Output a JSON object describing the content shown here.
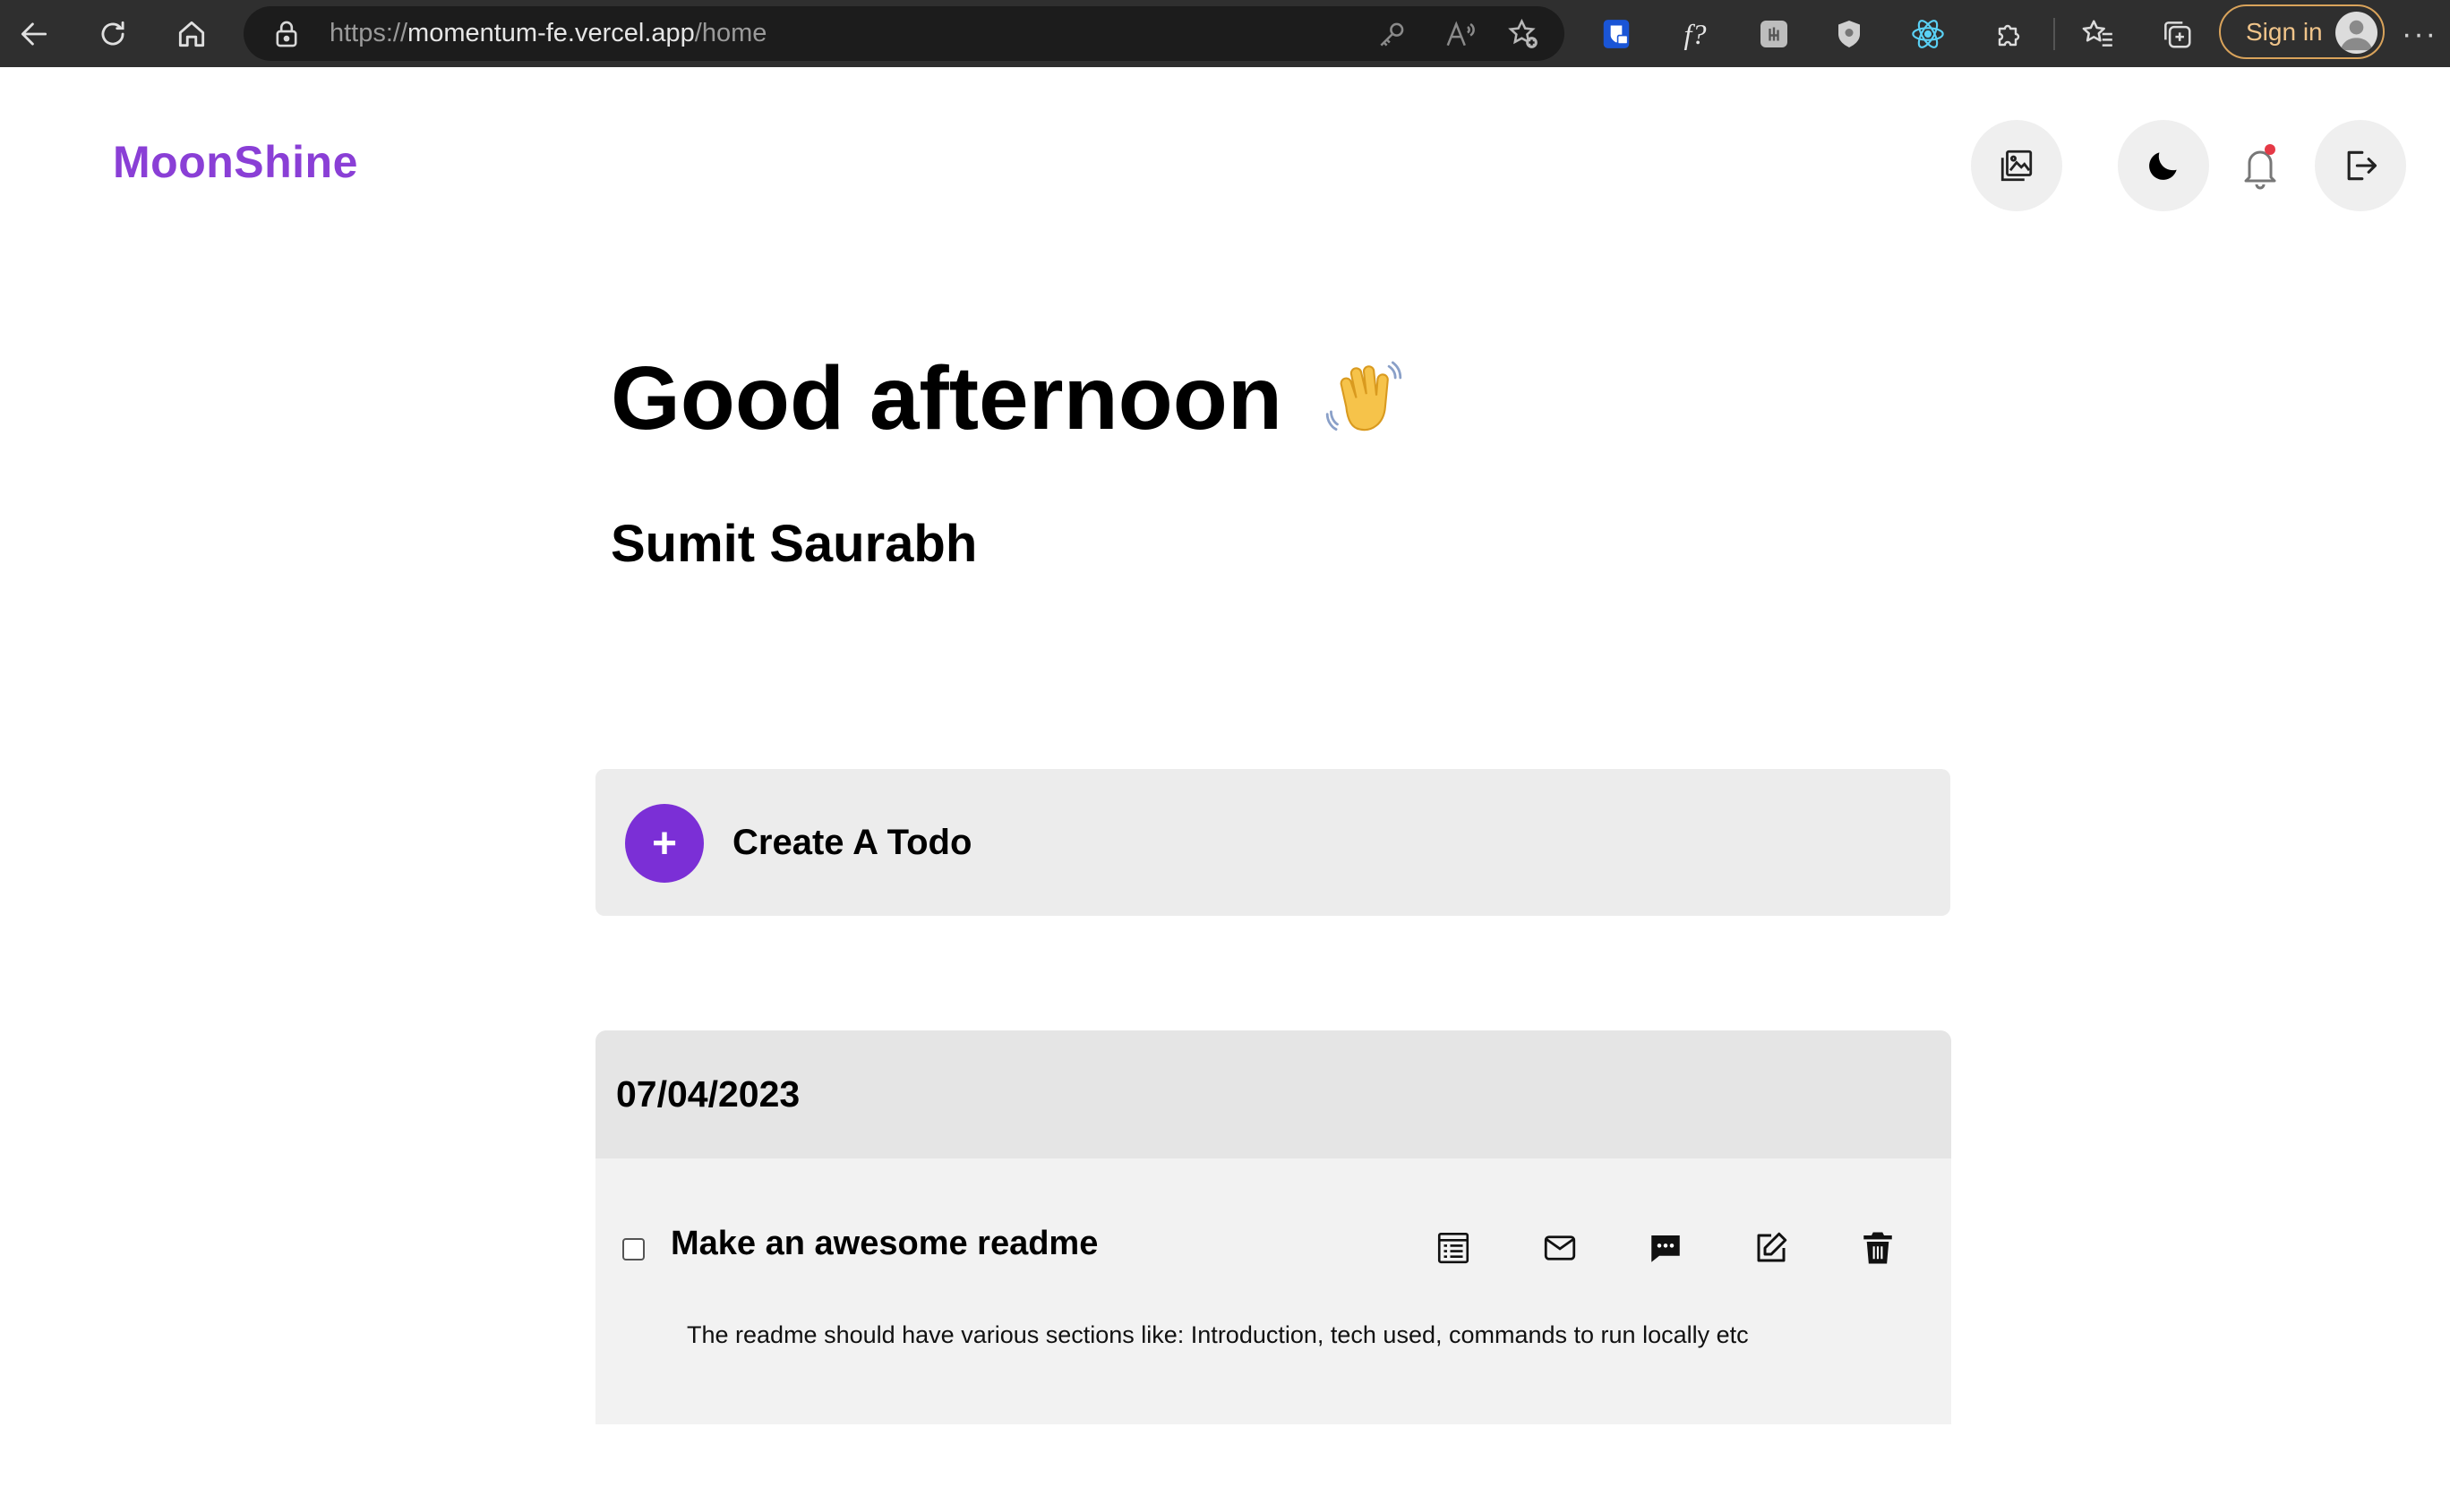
{
  "browser": {
    "url_scheme": "https://",
    "url_host": "momentum-fe.vercel.app",
    "url_path": "/home",
    "sign_in_label": "Sign in",
    "extension_f_label": "f?",
    "more_label": "···"
  },
  "header": {
    "brand": "MoonShine",
    "brand_color": "#8a3fd6",
    "icons": [
      "image-gallery-icon",
      "moon-icon",
      "bell-icon",
      "logout-icon"
    ]
  },
  "greeting": {
    "title": "Good afternoon",
    "user_name": "Sumit Saurabh"
  },
  "create_todo": {
    "label": "Create A Todo",
    "button_symbol": "+",
    "accent_color": "#7b2fd6"
  },
  "todo_groups": [
    {
      "date": "07/04/2023",
      "todos": [
        {
          "title": "Make an awesome readme",
          "description": "The readme should have various sections like: Introduction, tech used, commands to run locally etc",
          "completed": false,
          "actions": [
            "details-icon",
            "mail-icon",
            "comment-icon",
            "edit-icon",
            "trash-icon"
          ]
        }
      ]
    }
  ]
}
